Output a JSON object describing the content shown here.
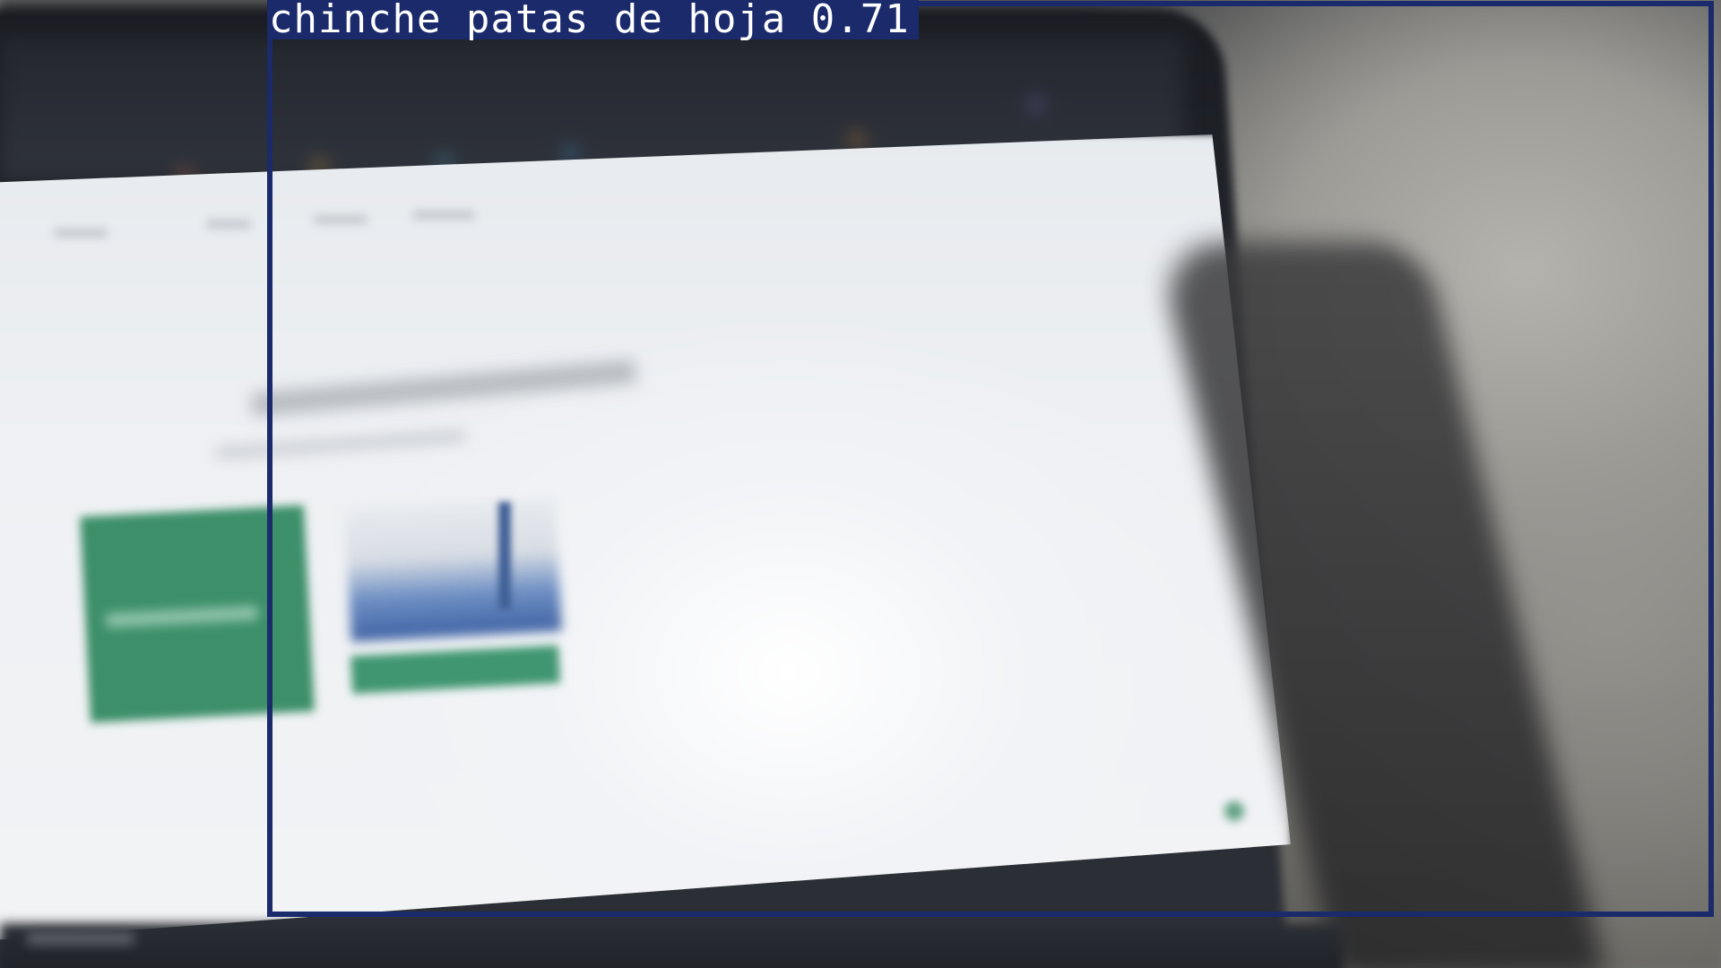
{
  "detection": {
    "label": "chinche patas de hoja 0.71",
    "box_color": "#1a2a6b",
    "label_text_color": "#ffffff"
  },
  "scene": {
    "screen_accent_green": "#3c8f69"
  }
}
